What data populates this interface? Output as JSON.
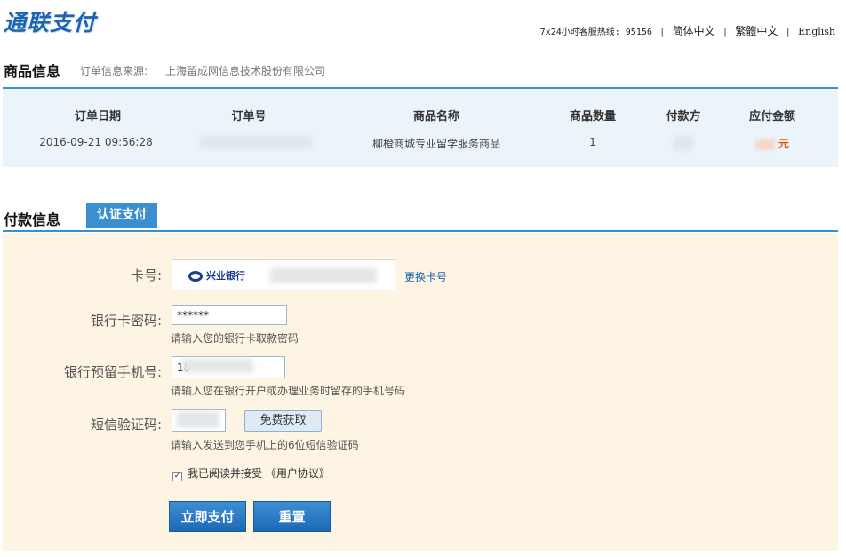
{
  "header": {
    "logo_text": "通联支付",
    "hotline": "7x24小时客服热线: 95156",
    "lang_simplified": "简体中文",
    "lang_traditional": "繁體中文",
    "lang_english": "English"
  },
  "goods_section": {
    "title": "商品信息",
    "order_source_label": "订单信息来源:",
    "order_source_value": "上海留成网信息技术股份有限公司"
  },
  "order_table": {
    "headers": [
      "订单日期",
      "订单号",
      "商品名称",
      "商品数量",
      "付款方",
      "应付金额"
    ],
    "row": {
      "date": "2016-09-21 09:56:28",
      "product_name": "柳橙商城专业留学服务商品",
      "quantity": "1",
      "amount_unit": "元"
    }
  },
  "payment_section": {
    "title": "付款信息",
    "tab_label": "认证支付"
  },
  "form": {
    "card_label": "卡号:",
    "bank_name": "兴业银行",
    "change_card": "更换卡号",
    "password_label": "银行卡密码:",
    "password_value": "******",
    "password_hint": "请输入您的银行卡取款密码",
    "phone_label": "银行预留手机号:",
    "phone_value": "18",
    "phone_hint": "请输入您在银行开户或办理业务时留存的手机号码",
    "sms_label": "短信验证码:",
    "get_code_button": "免费获取",
    "sms_hint": "请输入发送到您手机上的6位短信验证码",
    "agree_text": "我已阅读并接受",
    "agreement_link": "《用户协议》",
    "pay_button": "立即支付",
    "reset_button": "重置"
  },
  "colors": {
    "brand_blue": "#3a8fd0",
    "panel_bg": "#fdf4e4",
    "table_bg": "#ecf4fb",
    "amount_orange": "#e05a00"
  }
}
